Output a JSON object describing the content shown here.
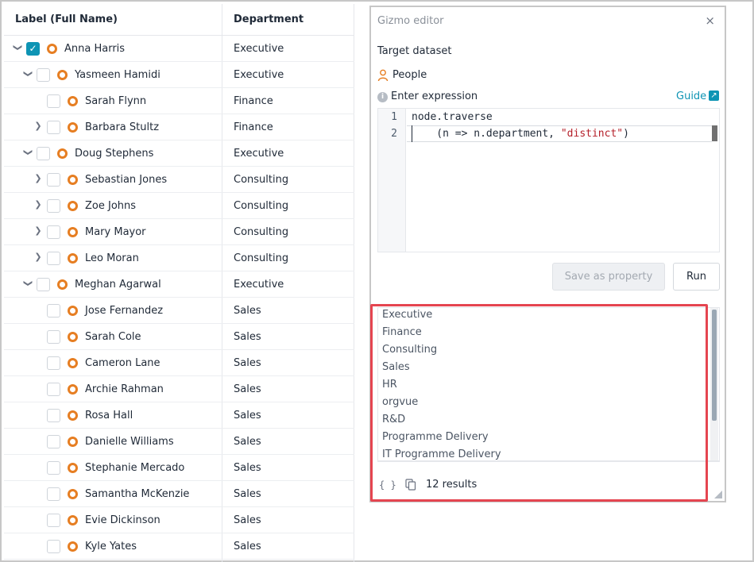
{
  "table": {
    "headers": {
      "label": "Label (Full Name)",
      "department": "Department"
    },
    "rows": [
      {
        "name": "Anna Harris",
        "department": "Executive"
      },
      {
        "name": "Yasmeen Hamidi",
        "department": "Executive"
      },
      {
        "name": "Sarah Flynn",
        "department": "Finance"
      },
      {
        "name": "Barbara Stultz",
        "department": "Finance"
      },
      {
        "name": "Doug Stephens",
        "department": "Executive"
      },
      {
        "name": "Sebastian Jones",
        "department": "Consulting"
      },
      {
        "name": "Zoe Johns",
        "department": "Consulting"
      },
      {
        "name": "Mary Mayor",
        "department": "Consulting"
      },
      {
        "name": "Leo Moran",
        "department": "Consulting"
      },
      {
        "name": "Meghan Agarwal",
        "department": "Executive"
      },
      {
        "name": "Jose Fernandez",
        "department": "Sales"
      },
      {
        "name": "Sarah Cole",
        "department": "Sales"
      },
      {
        "name": "Cameron Lane",
        "department": "Sales"
      },
      {
        "name": "Archie Rahman",
        "department": "Sales"
      },
      {
        "name": "Rosa Hall",
        "department": "Sales"
      },
      {
        "name": "Danielle Williams",
        "department": "Sales"
      },
      {
        "name": "Stephanie Mercado",
        "department": "Sales"
      },
      {
        "name": "Samantha McKenzie",
        "department": "Sales"
      },
      {
        "name": "Evie Dickinson",
        "department": "Sales"
      },
      {
        "name": "Kyle Yates",
        "department": "Sales"
      }
    ]
  },
  "gizmo": {
    "title": "Gizmo editor",
    "close": "×",
    "target_label": "Target dataset",
    "dataset": "People",
    "expr_label": "Enter expression",
    "guide": "Guide",
    "code": {
      "line1_no": "1",
      "line2_no": "2",
      "line1": "node.traverse",
      "line2_pre": "    (n => n.department, ",
      "line2_str": "\"distinct\"",
      "line2_post": ")"
    },
    "save_button": "Save as property",
    "run_button": "Run",
    "results": [
      "Executive",
      "Finance",
      "Consulting",
      "Sales",
      "HR",
      "orgvue",
      "R&D",
      "Programme Delivery",
      "IT Programme Delivery"
    ],
    "result_count": "12 results",
    "braces": "{ }"
  },
  "colors": {
    "accent": "#0e94b4",
    "node_ring": "#e67e22",
    "highlight": "#e54550"
  }
}
